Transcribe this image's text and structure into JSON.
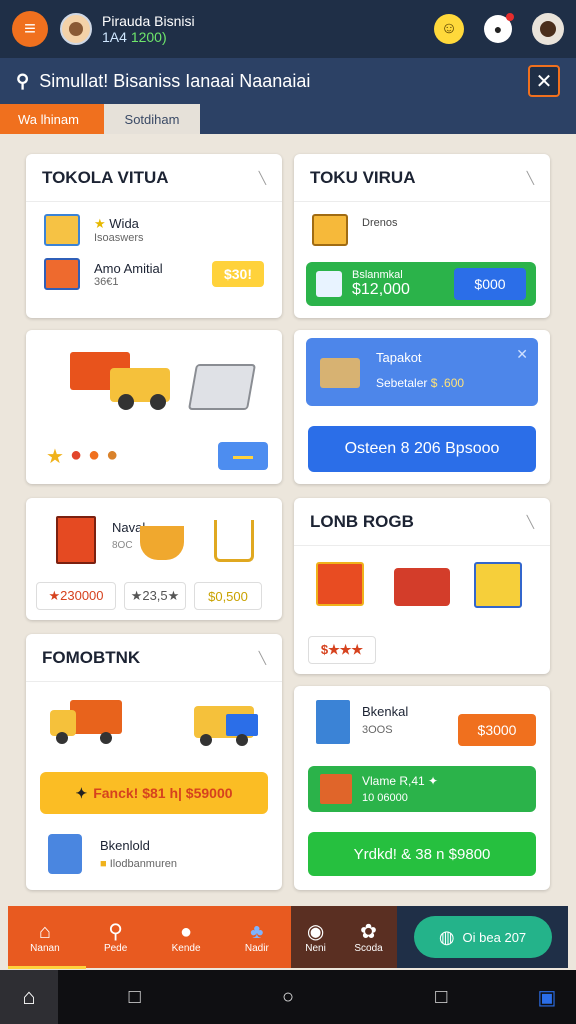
{
  "header": {
    "user_name": "Pirauda Bisnisi",
    "balance_prefix": "1A4",
    "balance_value": "1200)",
    "emoji": "☺",
    "bell": "●",
    "menu": "≡"
  },
  "titlebar": {
    "title": "Simullat! Bisaniss Ianaai Naanaiai",
    "search": "⚲",
    "close": "✕"
  },
  "tabs": [
    {
      "label": "Wa lhinam"
    },
    {
      "label": "Sotdiham"
    }
  ],
  "cards": {
    "tokola": {
      "title": "TOKOLA VITUA",
      "item1_title": "Wida",
      "item1_sub": "Isoaswers",
      "item2_title": "Amo Amitial",
      "item2_sub": "36€1",
      "item2_price": "$30!"
    },
    "toku": {
      "title": "TOKU VIRUA",
      "item1_title": "Drenos",
      "banner_label": "Bslanmkal",
      "banner_value": "$12,000",
      "banner_btn": "$000"
    },
    "vehicles": {
      "badges": [
        "★",
        "●",
        "●",
        "●"
      ],
      "btn": "▬▬"
    },
    "tapak": {
      "title": "Tapakot",
      "sub": "Sebetaler",
      "value": "$ .600",
      "close": "✕",
      "btn": "Osteen 8 206 Bpsooo"
    },
    "naval": {
      "title": "Naval",
      "sub": "8OC",
      "price1": "★230000",
      "price2": "★23,5★",
      "price3": "$0,500"
    },
    "lonb": {
      "title": "LONB ROGB",
      "price": "$★★★"
    },
    "fomob": {
      "title": "FOMOBTNK",
      "btn": "Fanck! $81 h| $59000",
      "item_title": "Bkenlold",
      "item_sub": "Ilodbanmuren"
    },
    "bkenkal": {
      "title": "Bkenkal",
      "sub": "3OOS",
      "price_btn": "$3000",
      "green_title": "Vlame R,41 ✦",
      "green_sub": "10 06000",
      "green_btn": "Yrdkd! & 38 n $9800"
    }
  },
  "bottomnav": {
    "items": [
      {
        "icon": "⌂",
        "label": "Nanan"
      },
      {
        "icon": "⚲",
        "label": "Pede"
      },
      {
        "icon": "●",
        "label": "Kende"
      },
      {
        "icon": "♣",
        "label": "Nadir"
      },
      {
        "icon": "◉",
        "label": "Neni"
      },
      {
        "icon": "✿",
        "label": "Scoda"
      }
    ],
    "promo_label": "Oi bea 207",
    "promo_icon": "◍"
  },
  "sysbar": {
    "home": "⌂",
    "square": "□",
    "circle": "○",
    "square2": "□",
    "corner": "▣"
  },
  "colors": {
    "orange": "#f0701e",
    "navy": "#1f2f47",
    "blue": "#2b6ee8",
    "green": "#2bb34a",
    "yellow": "#ffd23b"
  }
}
